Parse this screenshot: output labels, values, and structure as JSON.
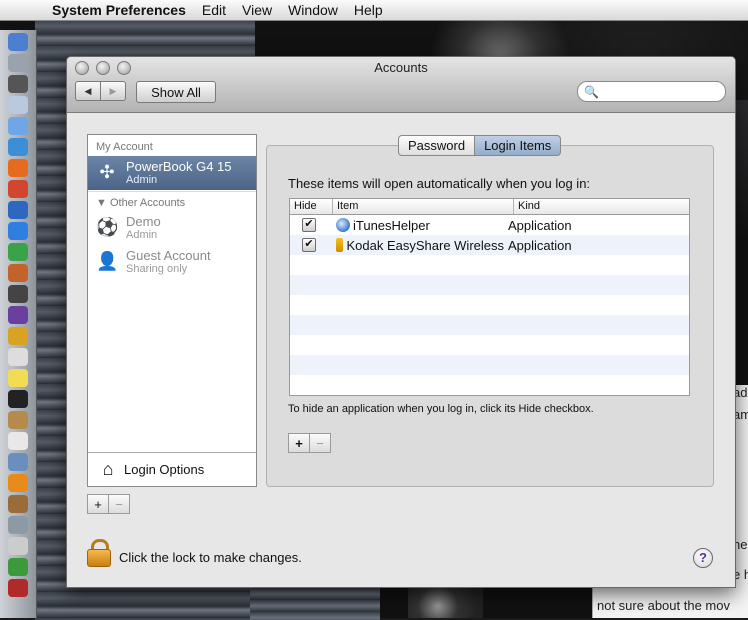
{
  "menubar": {
    "app_name": "System Preferences",
    "menus": [
      "Edit",
      "View",
      "Window",
      "Help"
    ]
  },
  "window": {
    "title": "Accounts",
    "show_all_label": "Show All",
    "search_placeholder": ""
  },
  "sidebar": {
    "my_account_header": "My Account",
    "current_account": {
      "name": "PowerBook G4 15",
      "role": "Admin"
    },
    "other_accounts_header": "Other Accounts",
    "other_accounts": [
      {
        "name": "Demo",
        "role": "Admin"
      },
      {
        "name": "Guest Account",
        "role": "Sharing only"
      }
    ],
    "login_options_label": "Login Options",
    "add_label": "+",
    "remove_label": "−"
  },
  "tabs": [
    "Password",
    "Login Items"
  ],
  "active_tab": "Login Items",
  "login_items": {
    "caption": "These items will open automatically when you log in:",
    "columns": [
      "Hide",
      "Item",
      "Kind"
    ],
    "rows": [
      {
        "hide": true,
        "item": "iTunesHelper",
        "kind": "Application",
        "icon": "itunes-icon"
      },
      {
        "hide": true,
        "item": "Kodak EasyShare Wireless",
        "kind": "Application",
        "icon": "kodak-icon"
      }
    ],
    "hint": "To hide an application when you log in, click its Hide checkbox.",
    "add_label": "+",
    "remove_label": "−"
  },
  "footer": {
    "lock_text": "Click the lock to make changes.",
    "help_label": "?"
  },
  "background": {
    "snippets": [
      "ad",
      "am",
      "ne",
      "e h"
    ],
    "bottom_text": "not sure about the mov"
  }
}
